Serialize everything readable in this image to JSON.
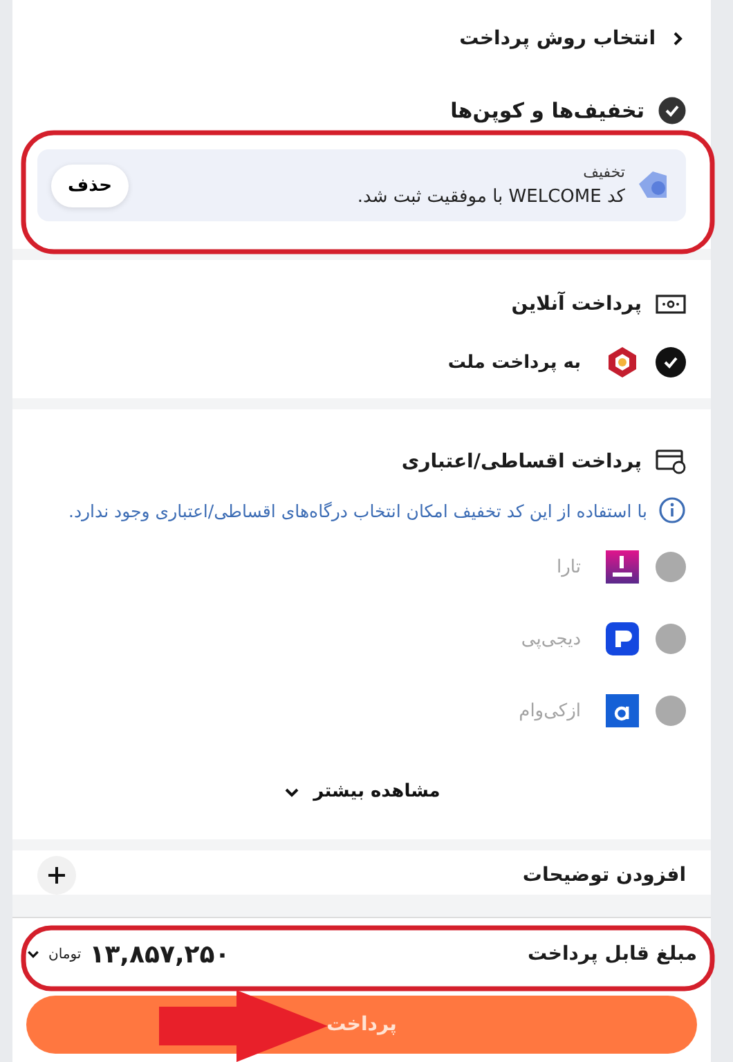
{
  "header": {
    "title": "انتخاب روش پرداخت"
  },
  "coupons": {
    "title": "تخفیف‌ها و کوپن‌ها",
    "checked": true,
    "coupon": {
      "label": "تخفیف",
      "message": "کد WELCOME با موفقیت ثبت شد.",
      "remove_button": "حذف"
    }
  },
  "online_payment": {
    "title": "پرداخت آنلاین",
    "options": [
      {
        "name": "به پرداخت ملت",
        "selected": true,
        "disabled": false,
        "kind": "mellat"
      }
    ]
  },
  "installment_payment": {
    "title": "پرداخت اقساطی/اعتباری",
    "notice": "با استفاده از این کد تخفیف امکان انتخاب درگاه‌های اقساطی/اعتباری وجود ندارد.",
    "options": [
      {
        "name": "تارا",
        "selected": false,
        "disabled": true,
        "kind": "tara"
      },
      {
        "name": "دیجی‌پی",
        "selected": false,
        "disabled": true,
        "kind": "digipay"
      },
      {
        "name": "ازکی‌وام",
        "selected": false,
        "disabled": true,
        "kind": "azki"
      }
    ],
    "show_more": "مشاهده بیشتر"
  },
  "notes": {
    "label": "افزودن توضیحات"
  },
  "total": {
    "label": "مبلغ قابل پرداخت",
    "amount": "۱۳,۸۵۷,۲۵۰",
    "currency": "تومان"
  },
  "pay_button": "پرداخت"
}
